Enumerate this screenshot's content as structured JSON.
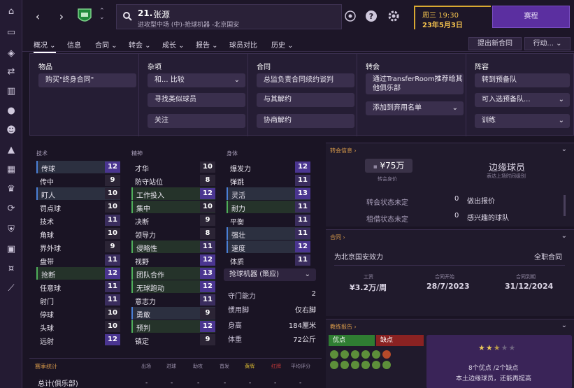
{
  "topbar": {
    "player_number": "21.",
    "player_name": "张源",
    "player_sub": "进攻型中场 (中)-抢球机器 -北京国安",
    "date_line1": "周三 19:30",
    "date_line2": "23年5月3日",
    "continue_label": "赛程"
  },
  "tabs": [
    {
      "label": "概况"
    },
    {
      "label": "信息"
    },
    {
      "label": "合同"
    },
    {
      "label": "转会"
    },
    {
      "label": "成长"
    },
    {
      "label": "报告"
    },
    {
      "label": "球员对比"
    },
    {
      "label": "历史"
    }
  ],
  "tab_buttons": {
    "new_contract": "提出新合同",
    "actions": "行动..."
  },
  "panel": {
    "items": {
      "title": "物品",
      "buy_lifetime": "购买\"终身合同\""
    },
    "misc": {
      "title": "杂项",
      "compare": "和... 比较",
      "find_similar": "寻找类似球员",
      "follow": "关注"
    },
    "contract": {
      "title": "合同",
      "manager_negotiate": "总监负责合同续约谈判",
      "terminate": "与其解约",
      "mutual": "协商解约"
    },
    "transfer": {
      "title": "转会",
      "transferroom": "通过TransferRoom推荐给其他俱乐部",
      "add_discard": "添加到弃用名单"
    },
    "squad": {
      "title": "阵容",
      "to_reserves": "转到预备队",
      "available_reserves": "可入选预备队...",
      "train": "训练"
    }
  },
  "attributes": {
    "technical_title": "技术",
    "mental_title": "精神",
    "physical_title": "身体",
    "technical": [
      {
        "name": "传球",
        "value": 12
      },
      {
        "name": "传中",
        "value": 9
      },
      {
        "name": "盯人",
        "value": 10
      },
      {
        "name": "罚点球",
        "value": 10
      },
      {
        "name": "技术",
        "value": 11
      },
      {
        "name": "角球",
        "value": 10
      },
      {
        "name": "界外球",
        "value": 9
      },
      {
        "name": "盘带",
        "value": 11
      },
      {
        "name": "抢断",
        "value": 12
      },
      {
        "name": "任意球",
        "value": 11
      },
      {
        "name": "射门",
        "value": 11
      },
      {
        "name": "停球",
        "value": 10
      },
      {
        "name": "头球",
        "value": 10
      },
      {
        "name": "远射",
        "value": 12
      }
    ],
    "mental": [
      {
        "name": "才华",
        "value": 10
      },
      {
        "name": "防守站位",
        "value": 8
      },
      {
        "name": "工作投入",
        "value": 12
      },
      {
        "name": "集中",
        "value": 10
      },
      {
        "name": "决断",
        "value": 9
      },
      {
        "name": "领导力",
        "value": 8
      },
      {
        "name": "侵略性",
        "value": 11
      },
      {
        "name": "视野",
        "value": 12
      },
      {
        "name": "团队合作",
        "value": 13
      },
      {
        "name": "无球跑动",
        "value": 12
      },
      {
        "name": "意志力",
        "value": 11
      },
      {
        "name": "勇敢",
        "value": 9
      },
      {
        "name": "预判",
        "value": 12
      },
      {
        "name": "镇定",
        "value": 9
      }
    ],
    "physical": [
      {
        "name": "爆发力",
        "value": 12
      },
      {
        "name": "弹跳",
        "value": 11
      },
      {
        "name": "灵活",
        "value": 13
      },
      {
        "name": "耐力",
        "value": 11
      },
      {
        "name": "平衡",
        "value": 11
      },
      {
        "name": "强壮",
        "value": 11
      },
      {
        "name": "速度",
        "value": 12
      },
      {
        "name": "体质",
        "value": 11
      }
    ],
    "role": "抢球机器 (策应)",
    "info": [
      {
        "k": "守门能力",
        "v": "2"
      },
      {
        "k": "惯用脚",
        "v": "仅右脚"
      },
      {
        "k": "身高",
        "v": "184厘米"
      },
      {
        "k": "体重",
        "v": "72公斤"
      }
    ]
  },
  "season": {
    "title": "赛季统计",
    "headers": [
      "出场",
      "进球",
      "助攻",
      "首发",
      "黄牌",
      "红牌",
      "平均评分"
    ],
    "row_label": "总计(俱乐部)",
    "row_values": [
      "-",
      "-",
      "-",
      "-",
      "-",
      "-",
      "-"
    ]
  },
  "transfer_card": {
    "title": "转会信息",
    "value": "¥75万",
    "value_caption": "转会身价",
    "status": "边缘球员",
    "status_caption": "表达上场时间级别",
    "rows": [
      {
        "k": "转会状态未定",
        "n": "0",
        "v": "做出报价"
      },
      {
        "k": "租借状态未定",
        "n": "0",
        "v": "感兴趣的球队"
      }
    ]
  },
  "contract_card": {
    "title": "合同",
    "club": "为北京国安效力",
    "type": "全职合同",
    "wage_caption": "工资",
    "wage": "¥3.2万/周",
    "start_caption": "合同开始",
    "start": "28/7/2023",
    "end_caption": "合同到期",
    "end": "31/12/2024"
  },
  "scout_card": {
    "title": "教练报告",
    "pros": "优点",
    "cons": "缺点",
    "stars": 2.5,
    "summary1": "8个优点 /2个缺点",
    "summary2": "本土边缘球员，还能再提高"
  },
  "colors": {
    "accent": "#5b2fa0",
    "date": "#f2c14e",
    "pros": "#2f7d32",
    "cons": "#8a2222"
  }
}
